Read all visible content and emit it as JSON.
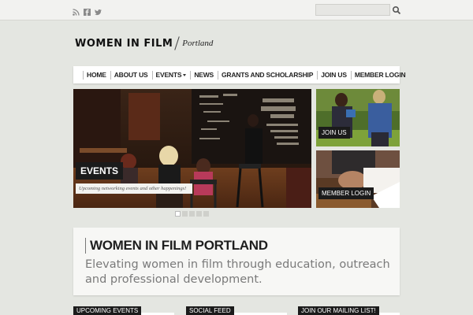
{
  "topbar": {
    "social_icons": [
      "rss-icon",
      "facebook-icon",
      "twitter-icon"
    ],
    "search": {
      "value": "",
      "placeholder": ""
    },
    "search_button_icon": "search-icon"
  },
  "logo": {
    "word": "WOMEN IN FILM",
    "city": "Portland"
  },
  "nav": {
    "items": [
      {
        "label": "HOME"
      },
      {
        "label": "ABOUT US"
      },
      {
        "label": "EVENTS",
        "has_dropdown": true
      },
      {
        "label": "NEWS"
      },
      {
        "label": "GRANTS AND SCHOLARSHIP"
      },
      {
        "label": "JOIN US"
      },
      {
        "label": "MEMBER LOGIN"
      }
    ]
  },
  "slider": {
    "label": "EVENTS",
    "caption": "Upcoming networking events and other happenings!",
    "slide_count": 5,
    "active_index": 0
  },
  "tiles": [
    {
      "label": "JOIN US"
    },
    {
      "label": "MEMBER LOGIN"
    }
  ],
  "intro": {
    "title": "WOMEN IN FILM PORTLAND",
    "text": "Elevating women in film through education, outreach and professional development."
  },
  "sections": [
    {
      "label": "UPCOMING EVENTS"
    },
    {
      "label": "SOCIAL FEED"
    },
    {
      "label": "JOIN OUR MAILING LIST!"
    }
  ],
  "colors": {
    "background": "#e4e6e1",
    "label_background": "#1b1b1b",
    "text_dark": "#1e1e1e",
    "text_muted": "#7a7a7a"
  }
}
